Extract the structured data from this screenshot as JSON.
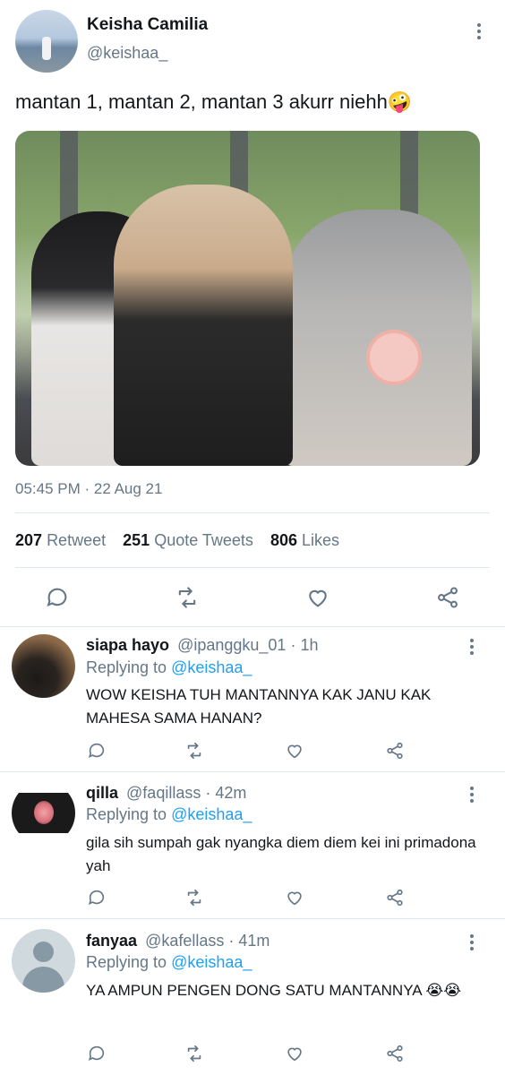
{
  "tweet": {
    "author_name": "Keisha Camilia",
    "author_handle": "@keishaa_",
    "text": "mantan 1, mantan 2, mantan 3 akurr niehh🤪",
    "timestamp": "05:45 PM · 22 Aug 21",
    "stats": {
      "retweets_count": "207",
      "retweets_label": "Retweet",
      "quotes_count": "251",
      "quotes_label": "Quote Tweets",
      "likes_count": "806",
      "likes_label": "Likes"
    }
  },
  "replies": [
    {
      "name": "siapa hayo",
      "handle": "@ipanggku_01",
      "time": "· 1h",
      "replying_label": "Replying to",
      "replying_to": "@keishaa_",
      "text": "WOW KEISHA TUH MANTANNYA KAK  JANU KAK MAHESA SAMA HANAN?"
    },
    {
      "name": "qilla",
      "handle": "@faqillass",
      "time": "· 42m",
      "replying_label": "Replying to",
      "replying_to": "@keishaa_",
      "text": "gila sih sumpah gak nyangka diem diem kei ini primadona yah"
    },
    {
      "name": "fanyaa",
      "handle": "@kafellass",
      "time": "· 41m",
      "replying_label": "Replying to",
      "replying_to": "@keishaa_",
      "text": "YA AMPUN PENGEN DONG SATU MANTANNYA 😭😭"
    }
  ],
  "icons": {
    "reply": "comment-icon",
    "retweet": "retweet-icon",
    "like": "heart-icon",
    "share": "share-icon",
    "more": "more-dots-icon"
  },
  "colors": {
    "text": "#14171a",
    "secondary": "#657786",
    "link": "#1da1f2",
    "divider": "#e1e8ed"
  }
}
